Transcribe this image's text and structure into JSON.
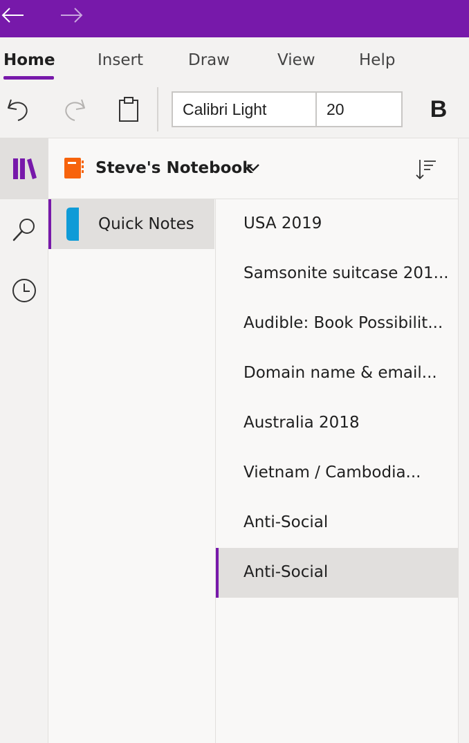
{
  "colors": {
    "accent": "#7719aa",
    "notebook": "#f7630c",
    "section": "#0f9bd7"
  },
  "titlebar": {
    "back_icon": "arrow-left-icon",
    "forward_icon": "arrow-right-icon"
  },
  "ribbon": {
    "tabs": [
      {
        "label": "Home",
        "active": true
      },
      {
        "label": "Insert"
      },
      {
        "label": "Draw"
      },
      {
        "label": "View"
      },
      {
        "label": "Help"
      }
    ],
    "tools": {
      "undo_icon": "undo-icon",
      "redo_icon": "redo-icon",
      "paste_icon": "clipboard-icon"
    },
    "font_name": "Calibri Light",
    "font_size": "20",
    "bold_label": "B"
  },
  "rail": {
    "items": [
      "notebooks-icon",
      "search-icon",
      "recent-clock-icon"
    ]
  },
  "notebook": {
    "title": "Steve's Notebook",
    "icon": "notebook-icon",
    "sort_icon": "sort-icon"
  },
  "sections": [
    {
      "label": "Quick Notes",
      "selected": true
    }
  ],
  "pages": [
    {
      "label": "USA 2019"
    },
    {
      "label": "Samsonite suitcase 201..."
    },
    {
      "label": "Audible: Book Possibilit..."
    },
    {
      "label": "Domain name & email..."
    },
    {
      "label": "Australia 2018"
    },
    {
      "label": "Vietnam / Cambodia..."
    },
    {
      "label": "Anti-Social"
    },
    {
      "label": "Anti-Social",
      "selected": true
    }
  ]
}
